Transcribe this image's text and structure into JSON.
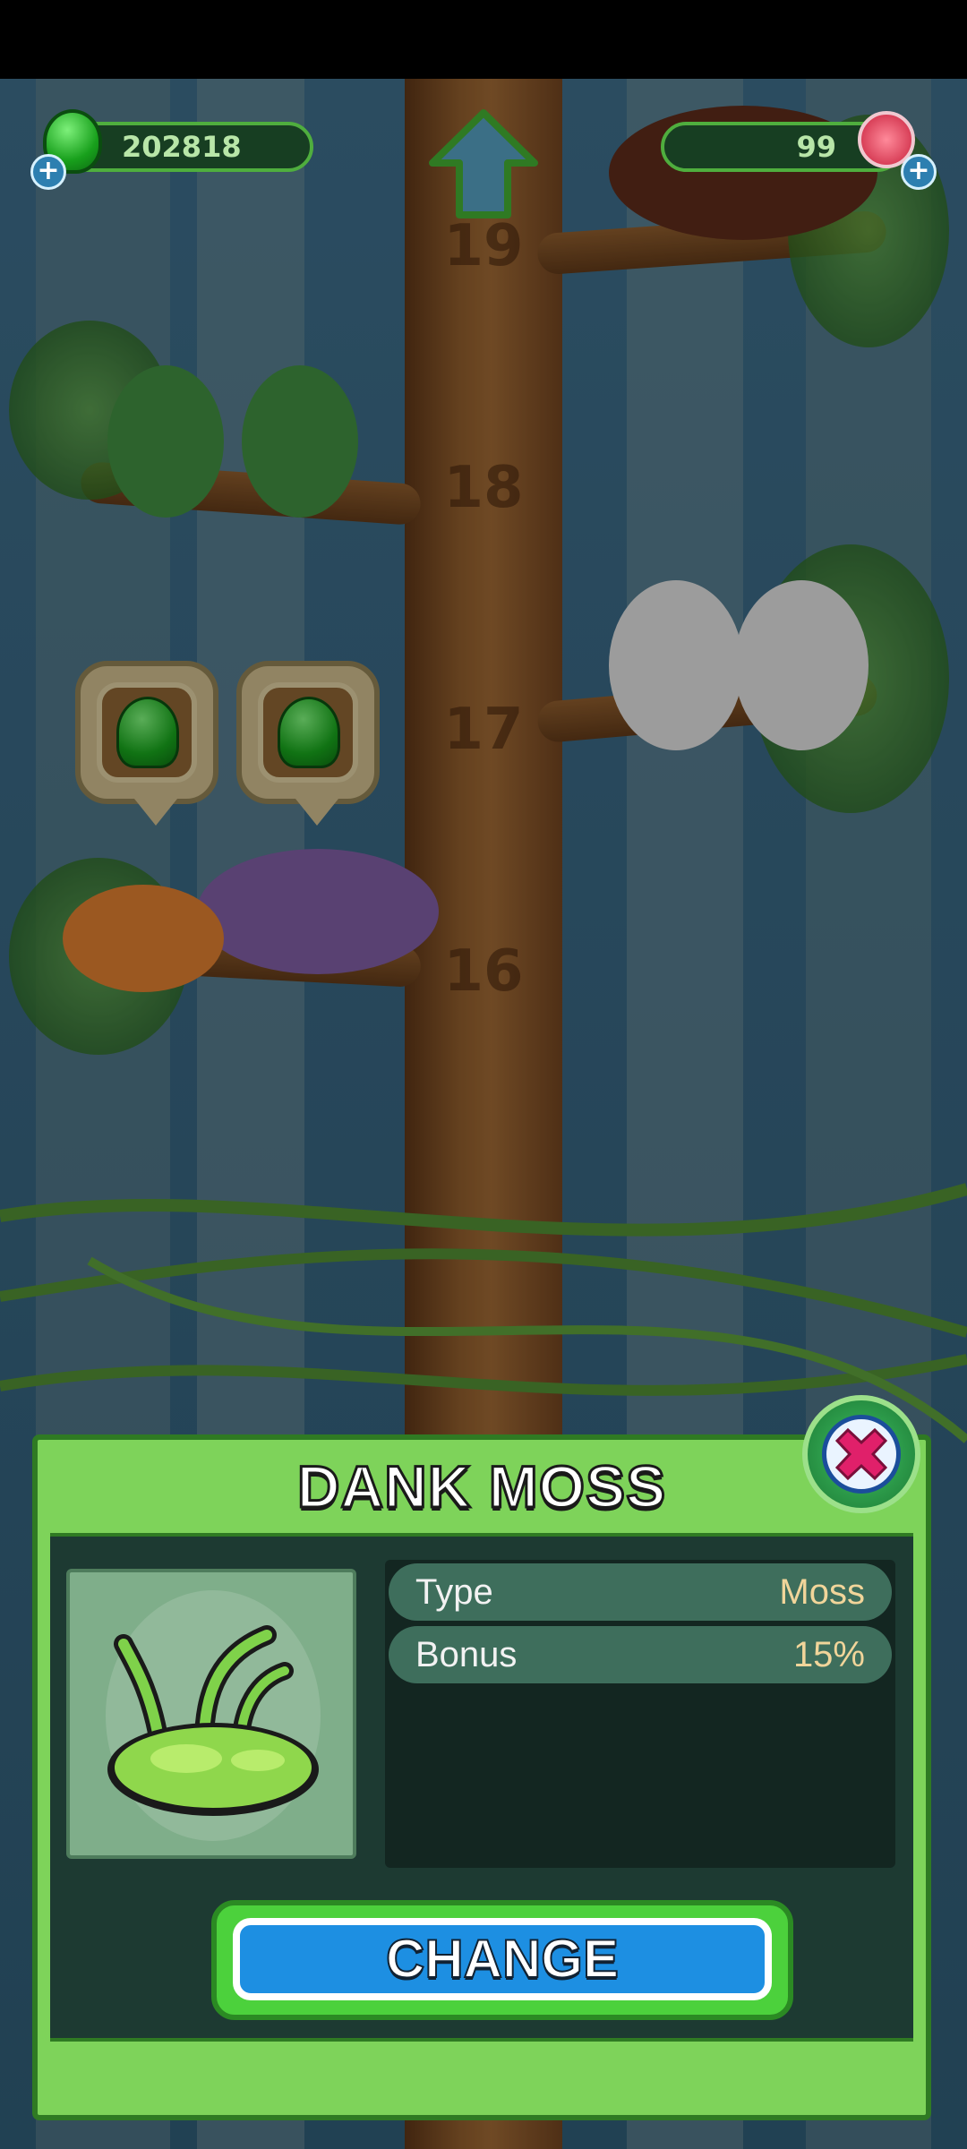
{
  "hud": {
    "green_currency": "202818",
    "gem_currency": "99"
  },
  "tree": {
    "levels": [
      "19",
      "18",
      "17",
      "16"
    ]
  },
  "dialog": {
    "title": "DANK MOSS",
    "stats": [
      {
        "label": "Type",
        "value": "Moss"
      },
      {
        "label": "Bonus",
        "value": "15%"
      }
    ],
    "change_label": "CHANGE"
  },
  "colors": {
    "dialog_green": "#7ed35a",
    "panel_dark": "#1d3a32",
    "button_blue": "#1d8fe2",
    "value_gold": "#f1d59a"
  },
  "icons": [
    "green-drop-icon",
    "plus-icon",
    "gem-icon",
    "up-arrow-icon",
    "close-icon",
    "moss-icon"
  ]
}
